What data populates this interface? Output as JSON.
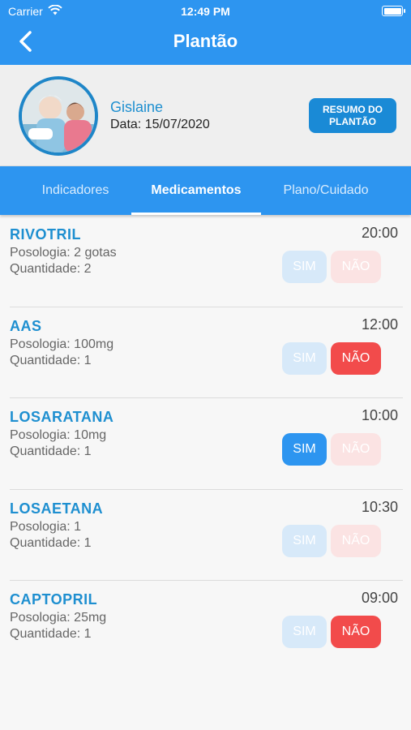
{
  "status_bar": {
    "carrier": "Carrier",
    "time": "12:49 PM"
  },
  "header": {
    "title": "Plantão"
  },
  "profile": {
    "name": "Gislaine",
    "date": "Data: 15/07/2020",
    "summary_button": "RESUMO DO PLANTÃO"
  },
  "tabs": [
    {
      "label": "Indicadores",
      "active": false
    },
    {
      "label": "Medicamentos",
      "active": true
    },
    {
      "label": "Plano/Cuidado",
      "active": false
    }
  ],
  "medications": [
    {
      "name": "RIVOTRIL",
      "time": "20:00",
      "posology": "Posologia: 2 gotas",
      "quantity": "Quantidade: 2",
      "sim_label": "SIM",
      "nao_label": "NÃO",
      "sim_active": false,
      "nao_active": false
    },
    {
      "name": "AAS",
      "time": "12:00",
      "posology": "Posologia: 100mg",
      "quantity": "Quantidade: 1",
      "sim_label": "SIM",
      "nao_label": "NÃO",
      "sim_active": false,
      "nao_active": true
    },
    {
      "name": "LOSARATANA",
      "time": "10:00",
      "posology": "Posologia: 10mg",
      "quantity": "Quantidade: 1",
      "sim_label": "SIM",
      "nao_label": "NÃO",
      "sim_active": true,
      "nao_active": false
    },
    {
      "name": "LOSAETANA",
      "time": "10:30",
      "posology": "Posologia: 1",
      "quantity": "Quantidade: 1",
      "sim_label": "SIM",
      "nao_label": "NÃO",
      "sim_active": false,
      "nao_active": false
    },
    {
      "name": "CAPTOPRIL",
      "time": "09:00",
      "posology": "Posologia: 25mg",
      "quantity": "Quantidade: 1",
      "sim_label": "SIM",
      "nao_label": "NÃO",
      "sim_active": false,
      "nao_active": true
    }
  ],
  "colors": {
    "primary": "#2d95f0",
    "accent_text": "#1e8fd0",
    "no_red": "#f24b4b"
  }
}
